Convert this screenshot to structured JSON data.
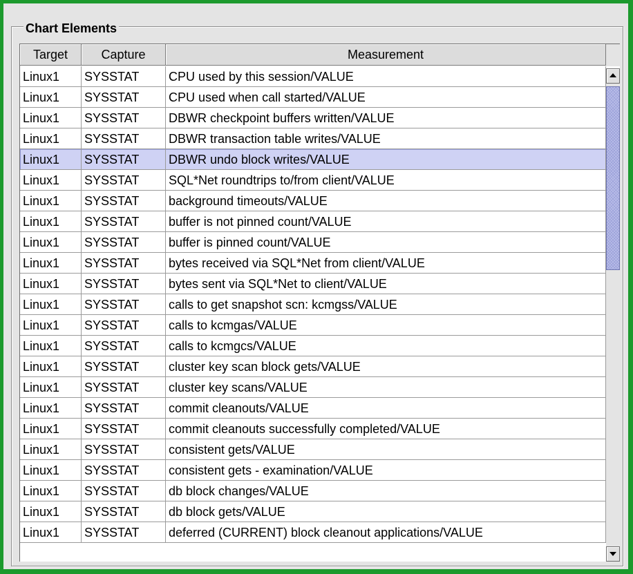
{
  "group": {
    "title": "Chart Elements"
  },
  "table": {
    "columns": [
      "Target",
      "Capture",
      "Measurement"
    ],
    "selected_row": 4,
    "rows": [
      [
        "Linux1",
        "SYSSTAT",
        "CPU used by this session/VALUE"
      ],
      [
        "Linux1",
        "SYSSTAT",
        "CPU used when call started/VALUE"
      ],
      [
        "Linux1",
        "SYSSTAT",
        "DBWR checkpoint buffers written/VALUE"
      ],
      [
        "Linux1",
        "SYSSTAT",
        "DBWR transaction table writes/VALUE"
      ],
      [
        "Linux1",
        "SYSSTAT",
        "DBWR undo block writes/VALUE"
      ],
      [
        "Linux1",
        "SYSSTAT",
        "SQL*Net roundtrips to/from client/VALUE"
      ],
      [
        "Linux1",
        "SYSSTAT",
        "background timeouts/VALUE"
      ],
      [
        "Linux1",
        "SYSSTAT",
        "buffer is not pinned count/VALUE"
      ],
      [
        "Linux1",
        "SYSSTAT",
        "buffer is pinned count/VALUE"
      ],
      [
        "Linux1",
        "SYSSTAT",
        "bytes received via SQL*Net from client/VALUE"
      ],
      [
        "Linux1",
        "SYSSTAT",
        "bytes sent via SQL*Net to client/VALUE"
      ],
      [
        "Linux1",
        "SYSSTAT",
        "calls to get snapshot scn: kcmgss/VALUE"
      ],
      [
        "Linux1",
        "SYSSTAT",
        "calls to kcmgas/VALUE"
      ],
      [
        "Linux1",
        "SYSSTAT",
        "calls to kcmgcs/VALUE"
      ],
      [
        "Linux1",
        "SYSSTAT",
        "cluster key scan block gets/VALUE"
      ],
      [
        "Linux1",
        "SYSSTAT",
        "cluster key scans/VALUE"
      ],
      [
        "Linux1",
        "SYSSTAT",
        "commit cleanouts/VALUE"
      ],
      [
        "Linux1",
        "SYSSTAT",
        "commit cleanouts successfully completed/VALUE"
      ],
      [
        "Linux1",
        "SYSSTAT",
        "consistent gets/VALUE"
      ],
      [
        "Linux1",
        "SYSSTAT",
        "consistent gets - examination/VALUE"
      ],
      [
        "Linux1",
        "SYSSTAT",
        "db block changes/VALUE"
      ],
      [
        "Linux1",
        "SYSSTAT",
        "db block gets/VALUE"
      ],
      [
        "Linux1",
        "SYSSTAT",
        "deferred (CURRENT) block cleanout applications/VALUE"
      ]
    ]
  },
  "scrollbar": {
    "up_icon": "arrow-up-icon",
    "down_icon": "arrow-down-icon",
    "thumb_color": "#b9bde8"
  },
  "colors": {
    "window_border": "#1c9a2d",
    "panel": "#e4e4e4",
    "selected_row": "#cfd2f4"
  }
}
